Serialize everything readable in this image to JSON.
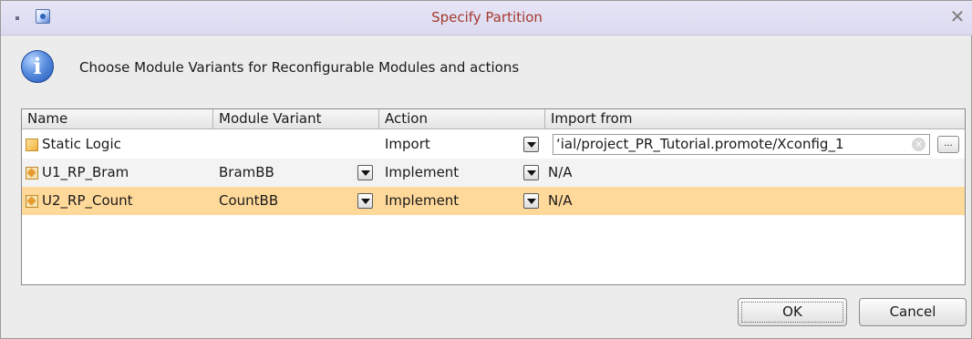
{
  "window": {
    "title": "Specify Partition",
    "close_glyph": "✕"
  },
  "message": {
    "icon": "info-icon",
    "text": "Choose Module Variants for Reconfigurable Modules and actions"
  },
  "table": {
    "columns": [
      "Name",
      "Module Variant",
      "Action",
      "Import from"
    ],
    "rows": [
      {
        "name": "Static Logic",
        "icon": "static-module-icon",
        "module_variant": "",
        "action": "Import",
        "import_from": "‘ial/project_PR_Tutorial.promote/Xconfig_1",
        "selected": false
      },
      {
        "name": "U1_RP_Bram",
        "icon": "reconfigurable-module-icon",
        "module_variant": "BramBB",
        "action": "Implement",
        "import_from": "N/A",
        "selected": false
      },
      {
        "name": "U2_RP_Count",
        "icon": "reconfigurable-module-icon",
        "module_variant": "CountBB",
        "action": "Implement",
        "import_from": "N/A",
        "selected": true
      }
    ]
  },
  "buttons": {
    "ok": "OK",
    "cancel": "Cancel",
    "browse": "..."
  },
  "colors": {
    "title_text": "#a33a2e",
    "selected_row": "#ffd99a"
  }
}
